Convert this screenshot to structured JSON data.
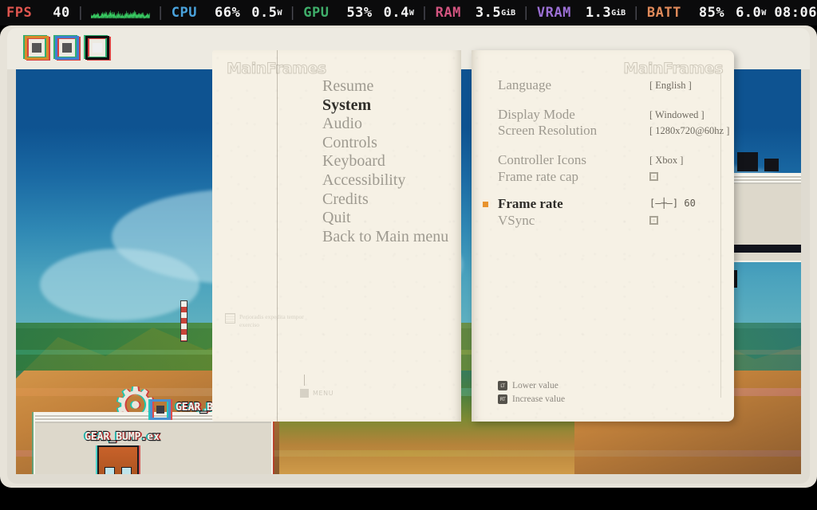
{
  "hud": {
    "segments": [
      {
        "label": "FPS",
        "color": "#e0564f",
        "value": "40",
        "unit": ""
      },
      {
        "label": "CPU",
        "color": "#4aa3dd",
        "value": "66%",
        "unit": "",
        "value2": "0.5",
        "unit2": "W"
      },
      {
        "label": "GPU",
        "color": "#3fae6a",
        "value": "53%",
        "unit": "",
        "value2": "0.4",
        "unit2": "W"
      },
      {
        "label": "RAM",
        "color": "#d2547f",
        "value": "3.5",
        "unit": "GiB"
      },
      {
        "label": "VRAM",
        "color": "#9b6fd4",
        "value": "1.3",
        "unit": "GiB"
      },
      {
        "label": "BATT",
        "color": "#e08a5a",
        "value": "85%",
        "unit": "",
        "value2": "6.0",
        "unit2": "W"
      }
    ],
    "clock": "08:06",
    "graph_color": "#3ddc6a"
  },
  "chrome": {
    "icons": [
      "square-target-orange-icon",
      "square-target-blue-icon",
      "square-target-dark-icon"
    ]
  },
  "game": {
    "labels": [
      {
        "text": "GEAR_BUMP.ex"
      },
      {
        "text": "GEAR_BU"
      }
    ]
  },
  "book": {
    "watermark_left": "MainFrames",
    "watermark_right": "MainFrames",
    "left_note": "Perioradis expedita tempor exerciso",
    "menu_hint": "MENU"
  },
  "menu": {
    "items": [
      {
        "label": "Resume",
        "selected": false
      },
      {
        "label": "System",
        "selected": true
      },
      {
        "label": "Audio",
        "selected": false
      },
      {
        "label": "Controls",
        "selected": false
      },
      {
        "label": "Keyboard",
        "selected": false
      },
      {
        "label": "Accessibility",
        "selected": false
      },
      {
        "label": "Credits",
        "selected": false
      },
      {
        "label": "Quit",
        "selected": false
      },
      {
        "label": "Back to Main menu",
        "selected": false
      }
    ]
  },
  "settings": {
    "accent_color": "#e8922e",
    "rows": [
      {
        "label": "Language",
        "value": "[ English ]",
        "kind": "value",
        "selected": false
      },
      {
        "label": "Display Mode",
        "value": "[ Windowed ]",
        "kind": "value",
        "selected": false
      },
      {
        "label": "Screen Resolution",
        "value": "[ 1280x720@60hz ]",
        "kind": "value",
        "selected": false
      },
      {
        "label": "Controller Icons",
        "value": "[ Xbox ]",
        "kind": "value",
        "selected": false
      },
      {
        "label": "Frame rate cap",
        "value": "",
        "kind": "checkbox",
        "selected": false
      },
      {
        "label": "Frame rate",
        "value": "[—┼—] 60",
        "kind": "slider",
        "selected": true,
        "slider_value": "60"
      },
      {
        "label": "VSync",
        "value": "",
        "kind": "checkbox",
        "selected": false
      }
    ],
    "hints": [
      {
        "key": "LT",
        "label": "Lower value"
      },
      {
        "key": "RT",
        "label": "Increase value"
      }
    ]
  }
}
